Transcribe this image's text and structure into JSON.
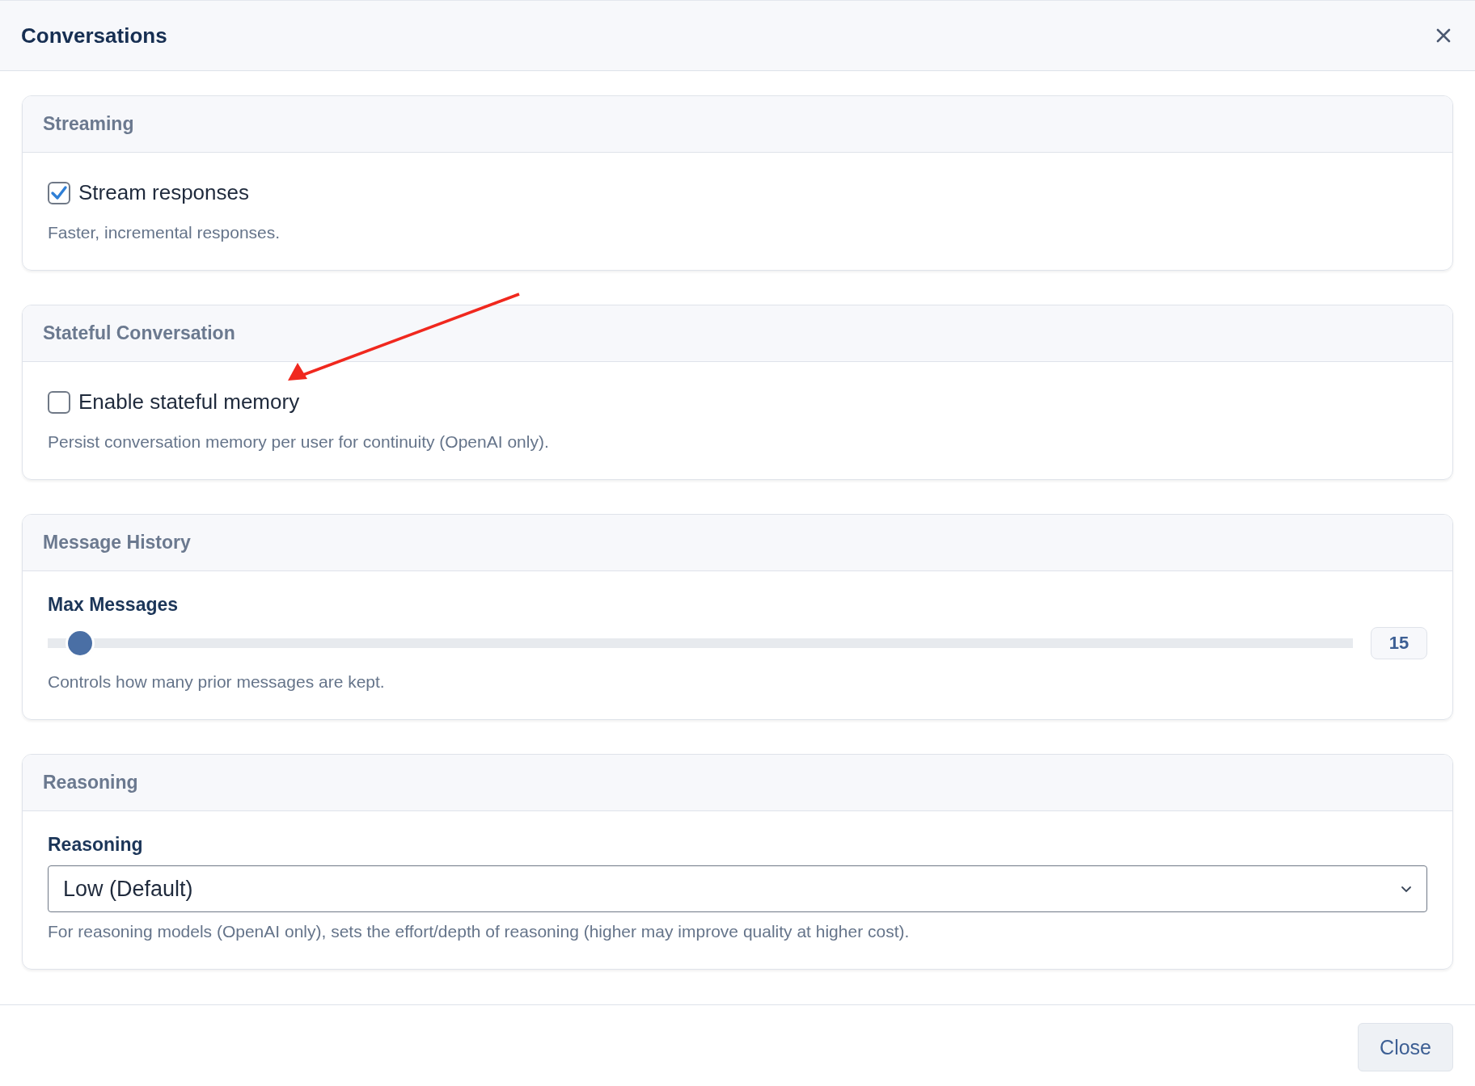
{
  "window": {
    "title": "Conversations"
  },
  "sections": [
    {
      "title": "Streaming",
      "kind": "checkbox",
      "label": "Stream responses",
      "checked": true,
      "hint": "Faster, incremental responses."
    },
    {
      "title": "Stateful Conversation",
      "kind": "checkbox",
      "label": "Enable stateful memory",
      "checked": false,
      "hint": "Persist conversation memory per user for continuity (OpenAI only)."
    },
    {
      "title": "Message History",
      "kind": "slider",
      "label": "Max Messages",
      "level": 0.016,
      "reading": "15",
      "hint": "Controls how many prior messages are kept."
    },
    {
      "title": "Reasoning",
      "kind": "select",
      "label": "Reasoning",
      "value": "Low (Default)",
      "hint": "For reasoning models (OpenAI only), sets the effort/depth of reasoning (higher may improve quality at higher cost)."
    }
  ],
  "footer": {
    "buttons": [
      "Close"
    ]
  }
}
